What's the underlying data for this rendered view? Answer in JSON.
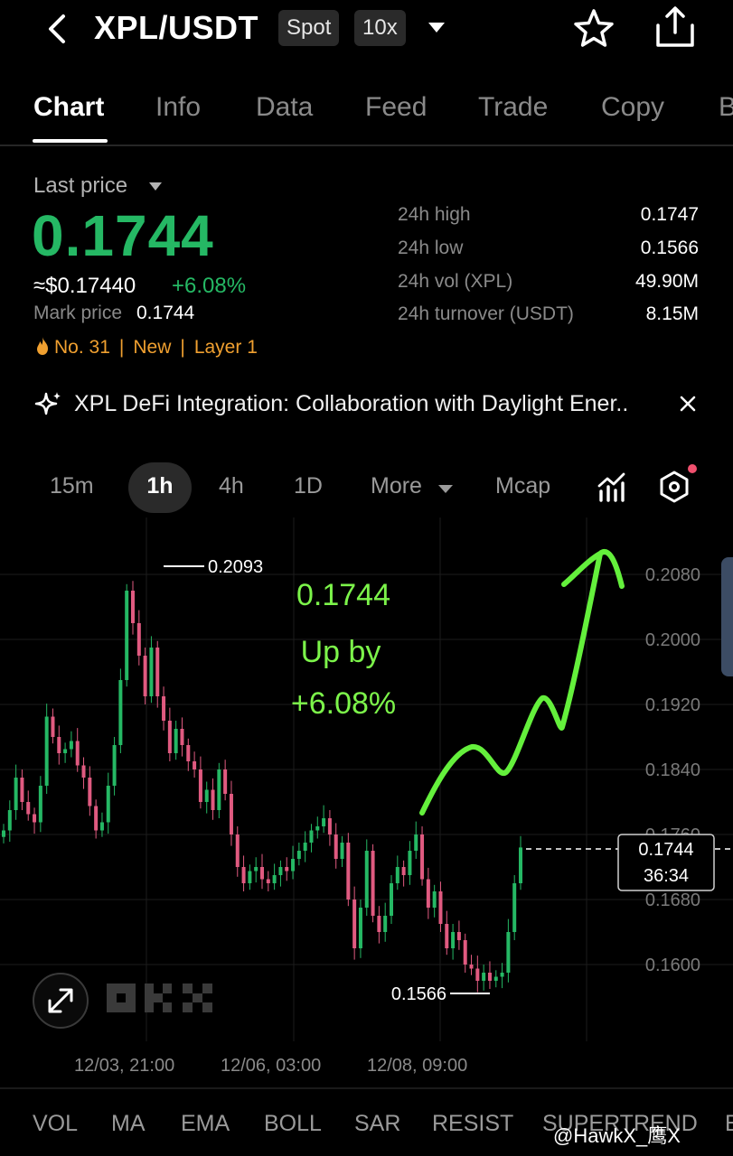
{
  "header": {
    "pair": "XPL/USDT",
    "market_chip": "Spot",
    "leverage_chip": "10x"
  },
  "tabs": [
    {
      "label": "Chart",
      "active": true
    },
    {
      "label": "Info"
    },
    {
      "label": "Data"
    },
    {
      "label": "Feed"
    },
    {
      "label": "Trade"
    },
    {
      "label": "Copy"
    },
    {
      "label": "B"
    }
  ],
  "price": {
    "label": "Last price",
    "last": "0.1744",
    "usd": "≈$0.17440",
    "change": "+6.08%",
    "mark_label": "Mark price",
    "mark": "0.1744",
    "tags": [
      "No. 31",
      "New",
      "Layer 1"
    ]
  },
  "stats": [
    {
      "label": "24h high",
      "value": "0.1747"
    },
    {
      "label": "24h low",
      "value": "0.1566"
    },
    {
      "label": "24h vol (XPL)",
      "value": "49.90M"
    },
    {
      "label": "24h turnover (USDT)",
      "value": "8.15M"
    }
  ],
  "news": {
    "text": "XPL DeFi Integration: Collaboration with Daylight Ener.."
  },
  "timeframes": {
    "items": [
      "15m",
      "1h",
      "4h",
      "1D",
      "More",
      "Mcap"
    ],
    "selected": "1h"
  },
  "chart_data": {
    "type": "candlestick",
    "y_ticks": [
      "0.2080",
      "0.2000",
      "0.1920",
      "0.1840",
      "0.1760",
      "0.1680",
      "0.1600"
    ],
    "x_ticks": [
      "12/03, 21:00",
      "12/06, 03:00",
      "12/08, 09:00"
    ],
    "high_label": "0.2093",
    "low_label": "0.1566",
    "current_price": "0.1744",
    "countdown": "36:34",
    "annotation": [
      "0.1744",
      "Up by",
      "+6.08%"
    ],
    "colors": {
      "up": "#25b864",
      "down": "#e05a80",
      "annotation": "#7cf44a"
    },
    "closes": [
      0.1765,
      0.179,
      0.183,
      0.18,
      0.1785,
      0.1775,
      0.182,
      0.1905,
      0.188,
      0.186,
      0.1865,
      0.1875,
      0.1845,
      0.183,
      0.1795,
      0.1765,
      0.1775,
      0.182,
      0.187,
      0.195,
      0.206,
      0.202,
      0.198,
      0.193,
      0.199,
      0.193,
      0.19,
      0.186,
      0.189,
      0.187,
      0.185,
      0.184,
      0.18,
      0.1815,
      0.179,
      0.184,
      0.181,
      0.176,
      0.172,
      0.17,
      0.1715,
      0.172,
      0.1705,
      0.17,
      0.171,
      0.172,
      0.1715,
      0.173,
      0.174,
      0.175,
      0.1765,
      0.177,
      0.178,
      0.176,
      0.173,
      0.175,
      0.168,
      0.162,
      0.167,
      0.174,
      0.166,
      0.164,
      0.166,
      0.17,
      0.172,
      0.171,
      0.174,
      0.176,
      0.1705,
      0.167,
      0.169,
      0.165,
      0.162,
      0.164,
      0.163,
      0.16,
      0.1595,
      0.158,
      0.159,
      0.158,
      0.1585,
      0.159,
      0.164,
      0.17,
      0.1744
    ]
  },
  "indicators": [
    "VOL",
    "MA",
    "EMA",
    "BOLL",
    "SAR",
    "RESIST",
    "SUPERTREND",
    "E"
  ],
  "watermark": "@HawkX_鹰X"
}
